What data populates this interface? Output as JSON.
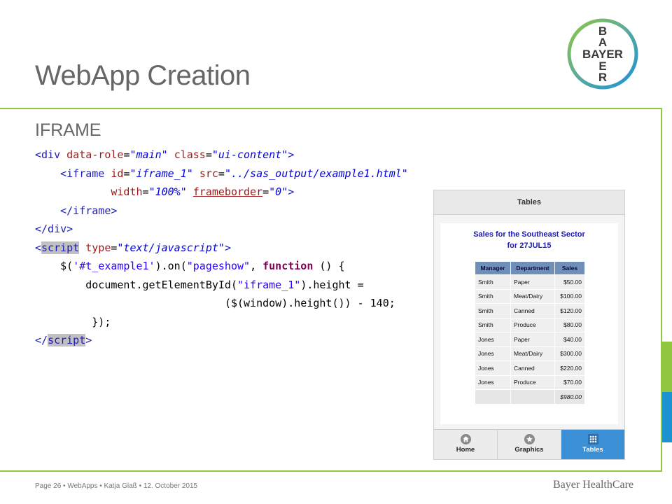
{
  "slide": {
    "title": "WebApp Creation",
    "subtitle": "IFRAME",
    "brand_colors": {
      "green": "#8fc73e",
      "blue": "#1b93d1"
    },
    "logo_letters": {
      "vertical_top": [
        "B",
        "A"
      ],
      "horizontal": "BAYER",
      "vertical_bottom": [
        "E",
        "R"
      ]
    }
  },
  "code": {
    "l1": {
      "a": "<div ",
      "b": "data-role",
      "c": "=",
      "d": "\"main\"",
      "e": " ",
      "f": "class",
      "g": "=",
      "h": "\"ui-content\"",
      "i": ">"
    },
    "l2": {
      "indent": "    ",
      "a": "<iframe ",
      "b": "id",
      "c": "=",
      "d": "\"iframe_1\"",
      "e": " ",
      "f": "src",
      "g": "=",
      "h": "\"../sas_output/example1.html\""
    },
    "l3": {
      "indent": "            ",
      "a": "width",
      "b": "=",
      "c": "\"100%\"",
      "d": " ",
      "e": "frameborder",
      "f": "=",
      "g": "\"0\"",
      "h": ">"
    },
    "l4": {
      "indent": "    ",
      "a": "</iframe>"
    },
    "l5": {
      "a": "</div>"
    },
    "l6": {
      "a": "<",
      "b": "script",
      "c": " ",
      "d": "type",
      "e": "=",
      "f": "\"text/javascript\"",
      "g": ">"
    },
    "l7": {
      "indent": "    ",
      "a": "$(",
      "b": "'#t_example1'",
      "c": ").on(",
      "d": "\"pageshow\"",
      "e": ", ",
      "f": "function",
      "g": " () {"
    },
    "l8": {
      "indent": "        ",
      "a": "document.getElementById(",
      "b": "\"iframe_1\"",
      "c": ").height ="
    },
    "l9": {
      "indent": "                              ",
      "a": "($(window).height()) - 140;"
    },
    "l10": {
      "indent": "         ",
      "a": "});"
    },
    "l11": {
      "a": "</",
      "b": "script",
      "c": ">"
    }
  },
  "phone": {
    "header": "Tables",
    "report_title_1": "Sales for the Southeast Sector",
    "report_title_2": "for 27JUL15",
    "columns": [
      "Manager",
      "Department",
      "Sales"
    ],
    "rows": [
      [
        "Smith",
        "Paper",
        "$50.00"
      ],
      [
        "Smith",
        "Meat/Dairy",
        "$100.00"
      ],
      [
        "Smith",
        "Canned",
        "$120.00"
      ],
      [
        "Smith",
        "Produce",
        "$80.00"
      ],
      [
        "Jones",
        "Paper",
        "$40.00"
      ],
      [
        "Jones",
        "Meat/Dairy",
        "$300.00"
      ],
      [
        "Jones",
        "Canned",
        "$220.00"
      ],
      [
        "Jones",
        "Produce",
        "$70.00"
      ]
    ],
    "total": "$980.00",
    "nav": [
      {
        "label": "Home",
        "icon": "home-icon",
        "active": false
      },
      {
        "label": "Graphics",
        "icon": "star-icon",
        "active": false
      },
      {
        "label": "Tables",
        "icon": "grid-icon",
        "active": true
      }
    ],
    "active_color": "#3b8fd4"
  },
  "footer": {
    "left": "Page 26 • WebApps • Katja Glaß • 12. October 2015",
    "right": "Bayer HealthCare"
  }
}
